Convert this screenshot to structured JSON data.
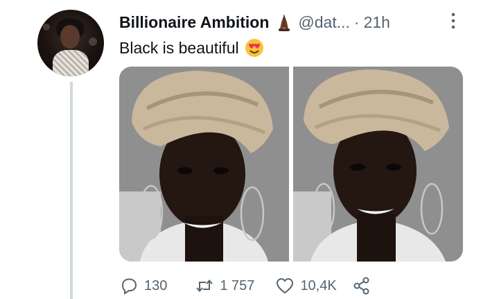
{
  "tweet": {
    "author_name": "Billionaire Ambition",
    "author_emoji_icon": "folded-hands-dark-skin-icon",
    "handle": "@dat...",
    "separator": "·",
    "time": "21h",
    "text": "Black is beautiful",
    "text_emoji_icon": "smiling-face-heart-eyes-icon",
    "media_count": 2
  },
  "actions": {
    "replies": "130",
    "retweets": "1 757",
    "likes": "10,4K"
  },
  "colors": {
    "text_primary": "#0f1419",
    "text_secondary": "#536471",
    "thread_line": "#cfd9de",
    "background": "#ffffff"
  }
}
